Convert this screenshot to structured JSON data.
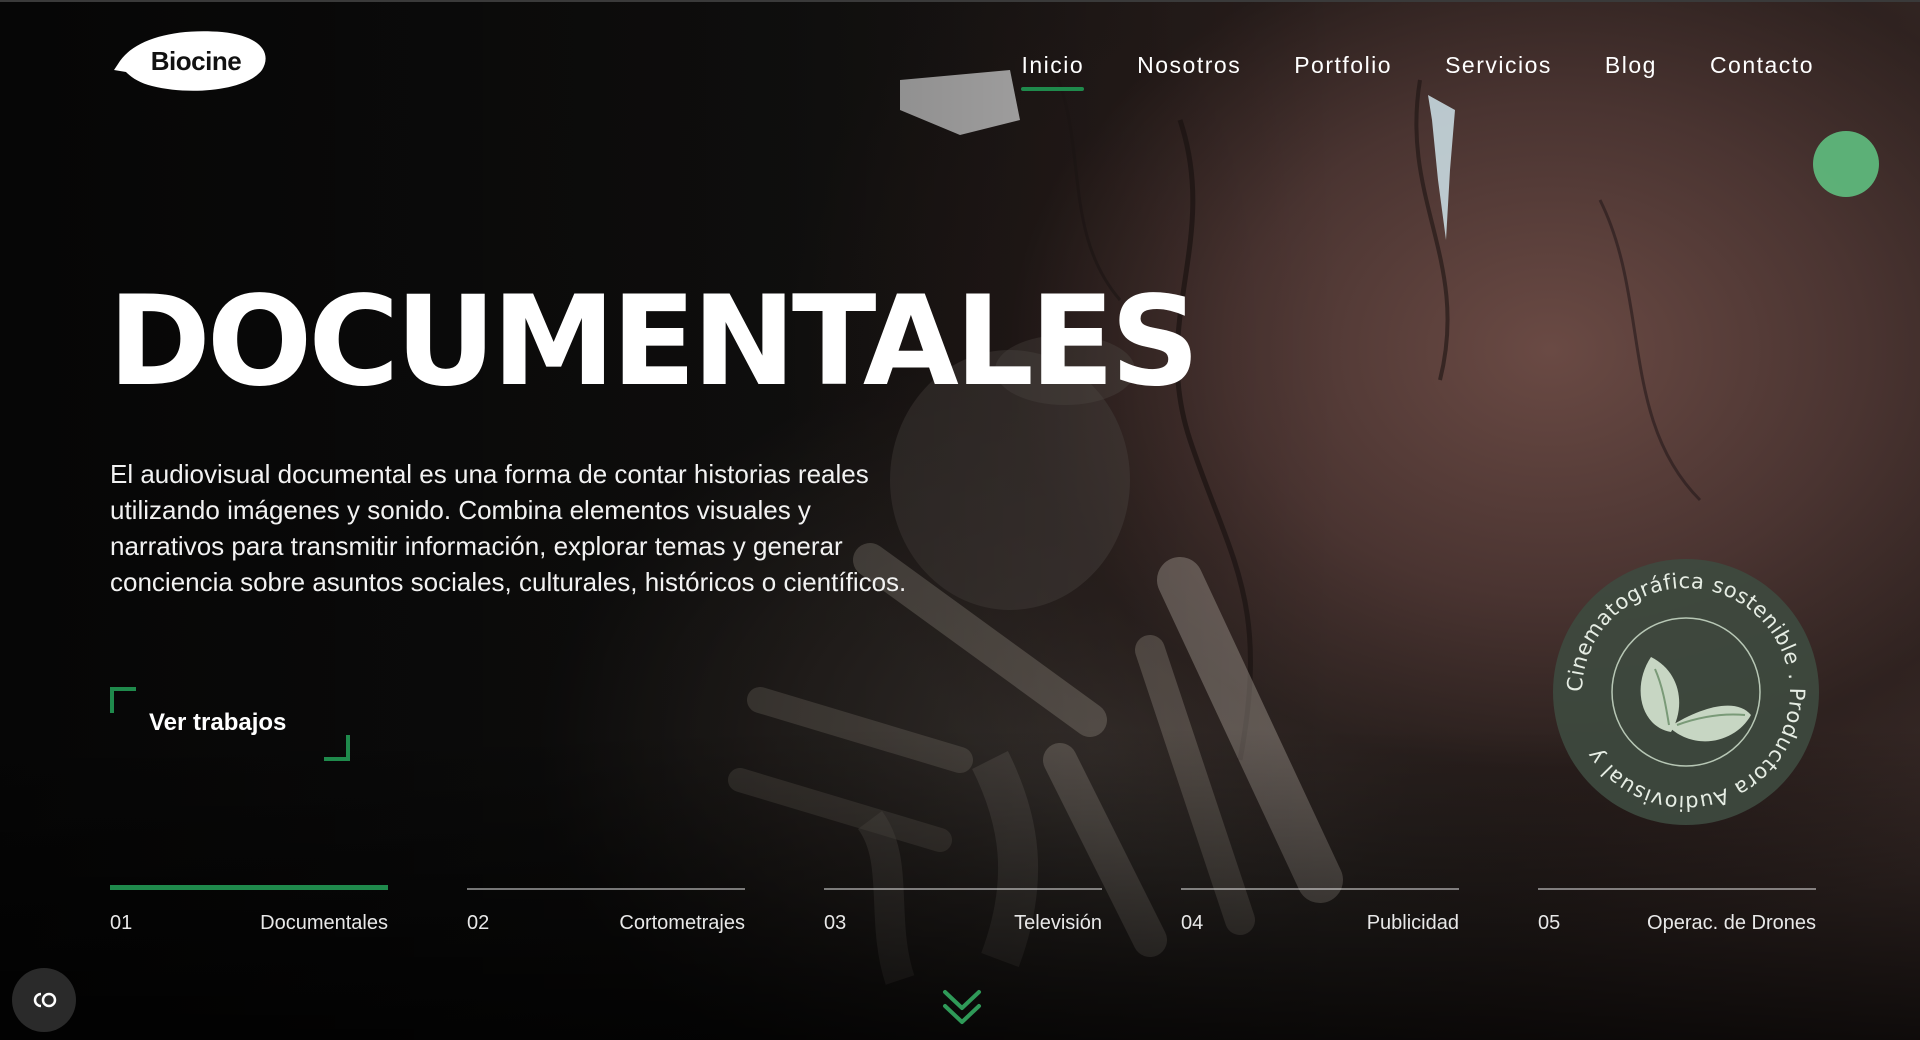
{
  "brand": {
    "logo_text": "Biocine"
  },
  "nav": {
    "items": [
      {
        "label": "Inicio",
        "active": true
      },
      {
        "label": "Nosotros"
      },
      {
        "label": "Portfolio"
      },
      {
        "label": "Servicios"
      },
      {
        "label": "Blog"
      },
      {
        "label": "Contacto"
      }
    ]
  },
  "hero": {
    "title": "DOCUMENTALES",
    "description": "El audiovisual documental es una forma de contar historias reales utilizando imágenes y sonido. Combina elementos visuales y narrativos para transmitir información, explorar temas y generar conciencia sobre asuntos sociales, culturales, históricos o científicos.",
    "cta_label": "Ver trabajos"
  },
  "badge": {
    "circular_text": "Cinematográfica sostenible . Productora Audiovisual y "
  },
  "tabs": [
    {
      "number": "01",
      "label": "Documentales",
      "active": true
    },
    {
      "number": "02",
      "label": "Cortometrajes"
    },
    {
      "number": "03",
      "label": "Televisión"
    },
    {
      "number": "04",
      "label": "Publicidad"
    },
    {
      "number": "05",
      "label": "Operac. de Drones"
    }
  ],
  "colors": {
    "accent": "#1f8a4c",
    "dot": "#5fbf7f",
    "badge_bg": "#3e4a3f"
  },
  "icons": {
    "scroll": "double-chevron-down-icon",
    "captions": "closed-captions-icon"
  }
}
